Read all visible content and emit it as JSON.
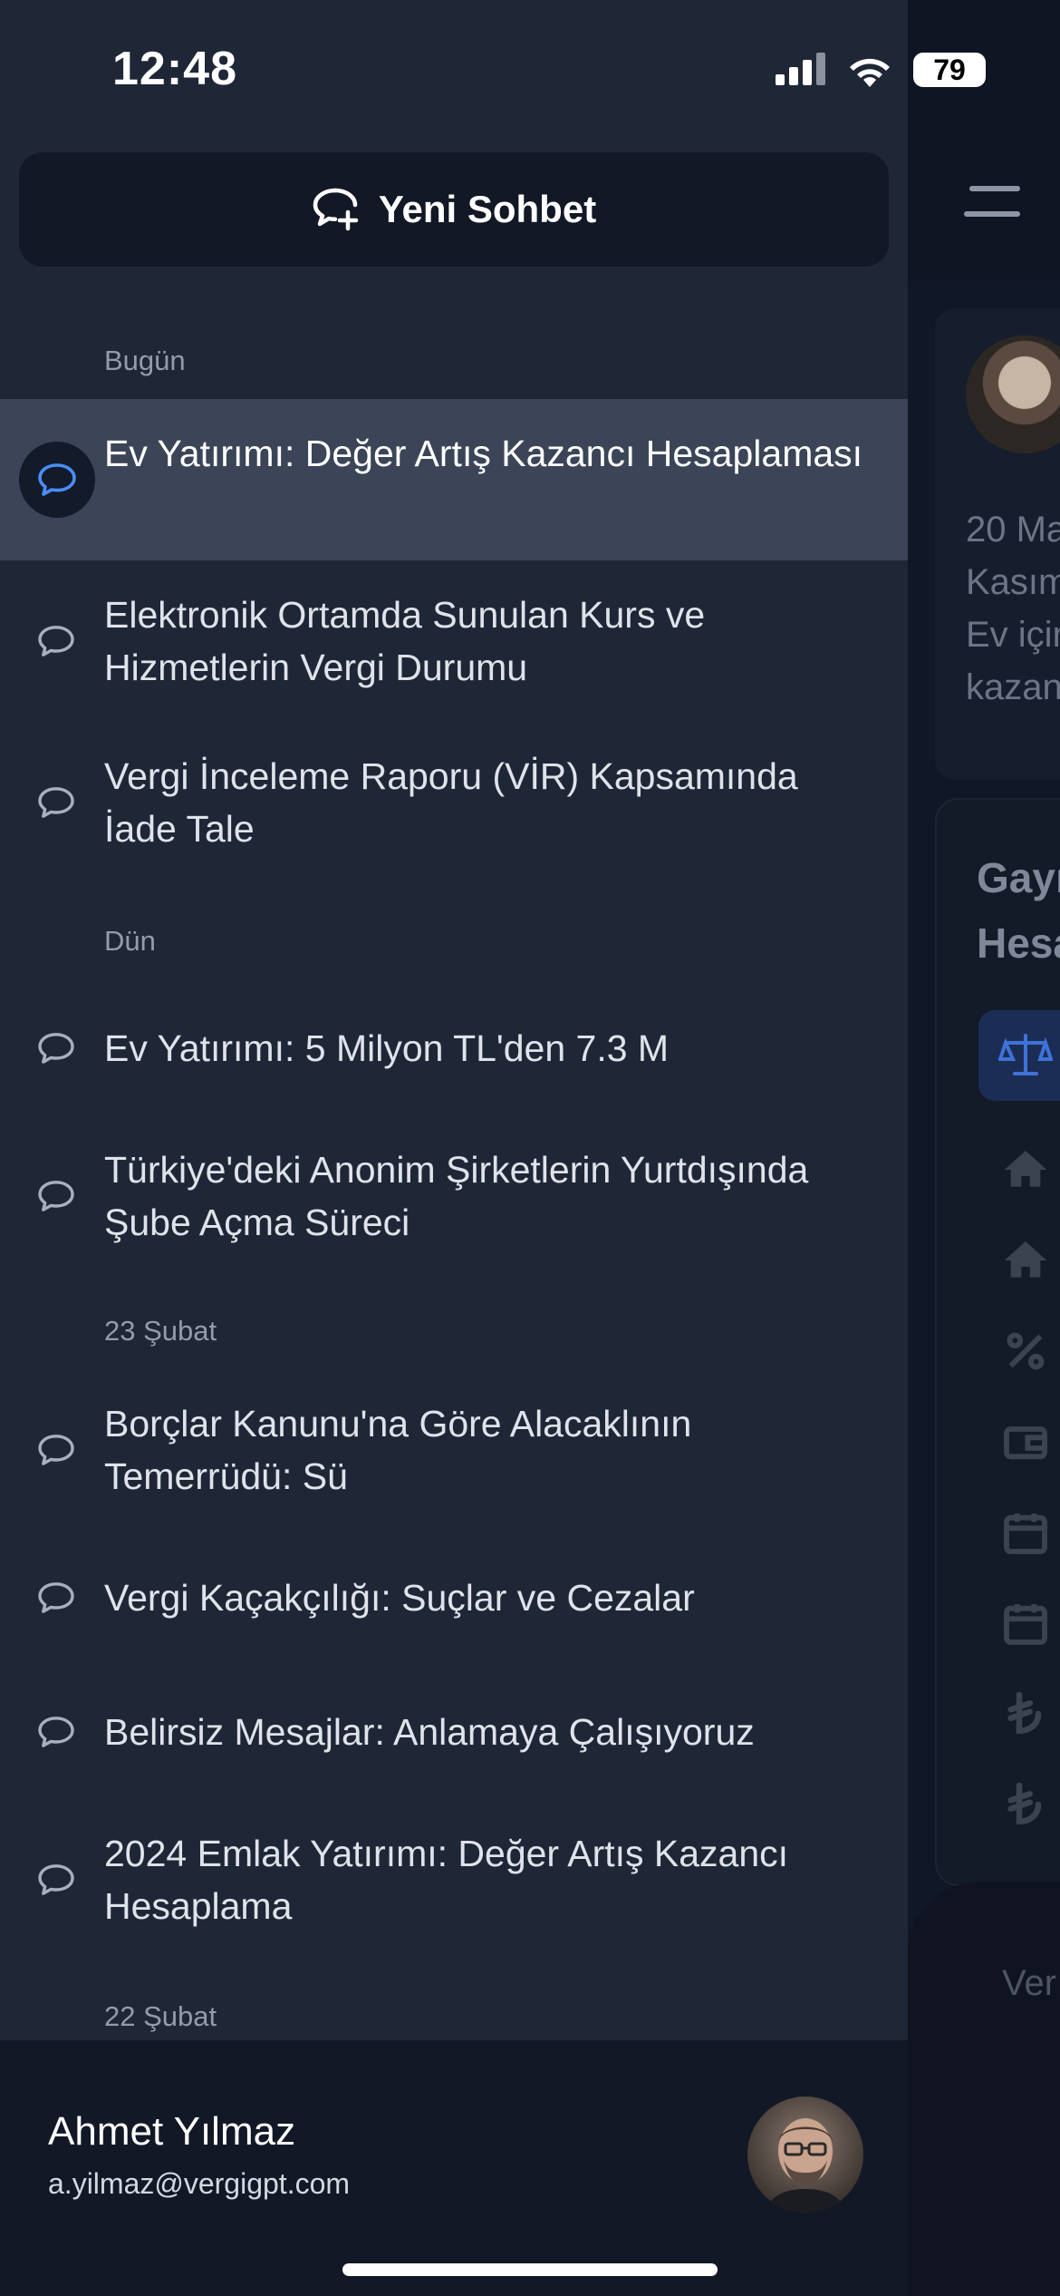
{
  "status_bar": {
    "time": "12:48",
    "battery": "79"
  },
  "new_chat": {
    "label": "Yeni Sohbet"
  },
  "sections": [
    {
      "label": "Bugün"
    },
    {
      "label": "Dün"
    },
    {
      "label": "23 Şubat"
    },
    {
      "label": "22 Şubat"
    }
  ],
  "conversations": [
    {
      "title": "Ev Yatırımı: Değer Artış Kazancı Hesaplaması",
      "active": true
    },
    {
      "title": "Elektronik Ortamda Sunulan Kurs ve Hizmetlerin Vergi Durumu"
    },
    {
      "title": "Vergi İnceleme Raporu (VİR) Kapsamında İade Tale"
    },
    {
      "title": "Ev Yatırımı: 5 Milyon TL'den 7.3 M"
    },
    {
      "title": "Türkiye'deki Anonim Şirketlerin Yurtdışında Şube Açma Süreci"
    },
    {
      "title": "Borçlar Kanunu'na Göre Alacaklının Temerrüdü: Sü"
    },
    {
      "title": "Vergi Kaçakçılığı: Suçlar ve Cezalar"
    },
    {
      "title": "Belirsiz Mesajlar: Anlamaya Çalışıyoruz"
    },
    {
      "title": "2024 Emlak Yatırımı: Değer Artış Kazancı Hesaplama"
    }
  ],
  "user": {
    "name": "Ahmet Yılmaz",
    "email": "a.yilmaz@vergigpt.com"
  },
  "background_app": {
    "card_text": [
      "20 Ma",
      "Kasım",
      "Ev için",
      "kazan"
    ],
    "card_title": [
      "Gayr",
      "Hesa"
    ],
    "bottom_text": "Ver"
  },
  "colors": {
    "accent": "#4b8df8",
    "drawer_bg": "#1f2737",
    "active_row": "#3b4557",
    "footer_bg": "#121826"
  }
}
